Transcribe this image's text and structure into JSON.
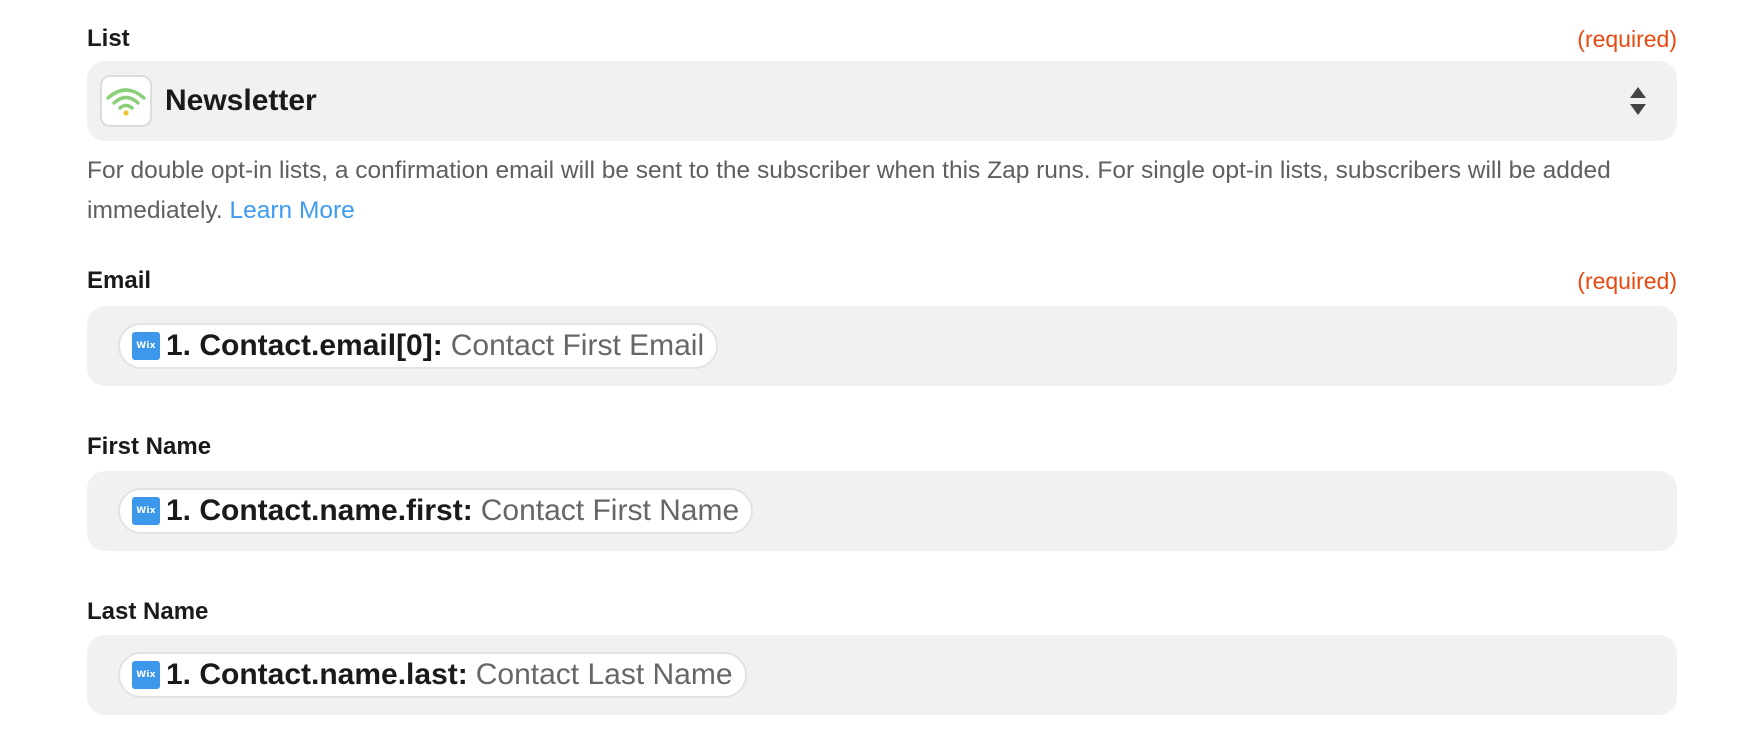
{
  "list_field": {
    "label": "List",
    "required": "(required)",
    "value": "Newsletter",
    "icon": "signal-waves-icon",
    "help_text": "For double opt-in lists, a confirmation email will be sent to the subscriber when this Zap runs. For single opt-in lists, subscribers will be added immediately.",
    "help_link": "Learn More"
  },
  "email_field": {
    "label": "Email",
    "required": "(required)",
    "pill": {
      "app_icon": "Wix",
      "key": "1. Contact.email[0]:",
      "value": "Contact First Email"
    }
  },
  "first_name_field": {
    "label": "First Name",
    "pill": {
      "app_icon": "Wix",
      "key": "1. Contact.name.first:",
      "value": "Contact First Name"
    }
  },
  "last_name_field": {
    "label": "Last Name",
    "pill": {
      "app_icon": "Wix",
      "key": "1. Contact.name.last:",
      "value": "Contact Last Name"
    }
  },
  "colors": {
    "required": "#e8490f",
    "link": "#3d9bf0",
    "field_background": "#f1f1f1",
    "wix_badge": "#3d97ea"
  }
}
